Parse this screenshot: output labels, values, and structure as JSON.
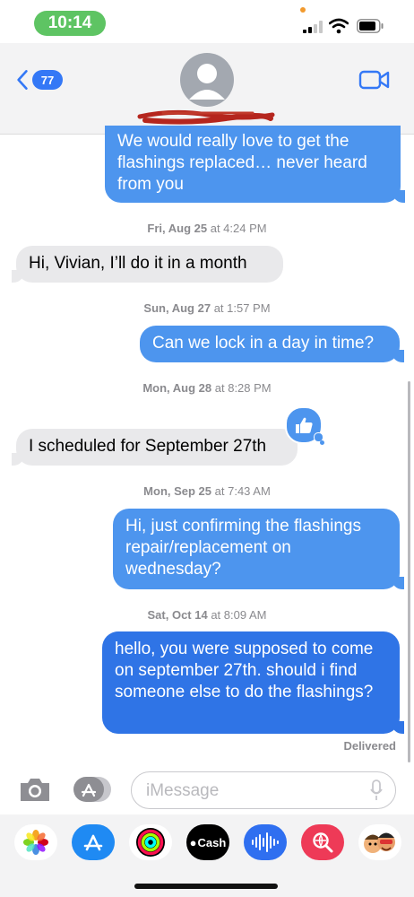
{
  "status": {
    "time": "10:14"
  },
  "header": {
    "unread_count": "77"
  },
  "thread": {
    "messages": [
      {
        "text": "We would really love to get the flashings replaced… never heard from you"
      },
      {
        "text": "Hi, Vivian, I’ll do it in  a month"
      },
      {
        "text": "Can we lock in a day in time?"
      },
      {
        "text": "I scheduled for September 27th"
      },
      {
        "text": "Hi, just confirming the flashings repair/replacement on wednesday?"
      },
      {
        "text": "hello, you were supposed to come on september 27th. should i find someone else to do the flashings?"
      }
    ],
    "timestamps": [
      {
        "day": "Fri, Aug 25",
        "time": "at 4:24 PM"
      },
      {
        "day": "Sun, Aug 27",
        "time": "at 1:57 PM"
      },
      {
        "day": "Mon, Aug 28",
        "time": "at 8:28 PM"
      },
      {
        "day": "Mon, Sep 25",
        "time": "at 7:43 AM"
      },
      {
        "day": "Sat, Oct 14",
        "time": "at 8:09 AM"
      }
    ],
    "status_text": "Delivered",
    "tapback": "thumbs-up-icon"
  },
  "input": {
    "placeholder": "iMessage"
  },
  "apps": [
    {
      "name": "photos-icon"
    },
    {
      "name": "app-store-icon"
    },
    {
      "name": "activity-icon"
    },
    {
      "name": "apple-cash-icon",
      "label": "Cash"
    },
    {
      "name": "audio-message-icon"
    },
    {
      "name": "image-search-icon"
    },
    {
      "name": "memoji-icon"
    }
  ],
  "colors": {
    "outgoing": "#4d95ee",
    "outgoing_latest": "#2f74e6",
    "incoming": "#e9e9eb",
    "accent": "#3478f6",
    "time_pill": "#5ec463"
  }
}
